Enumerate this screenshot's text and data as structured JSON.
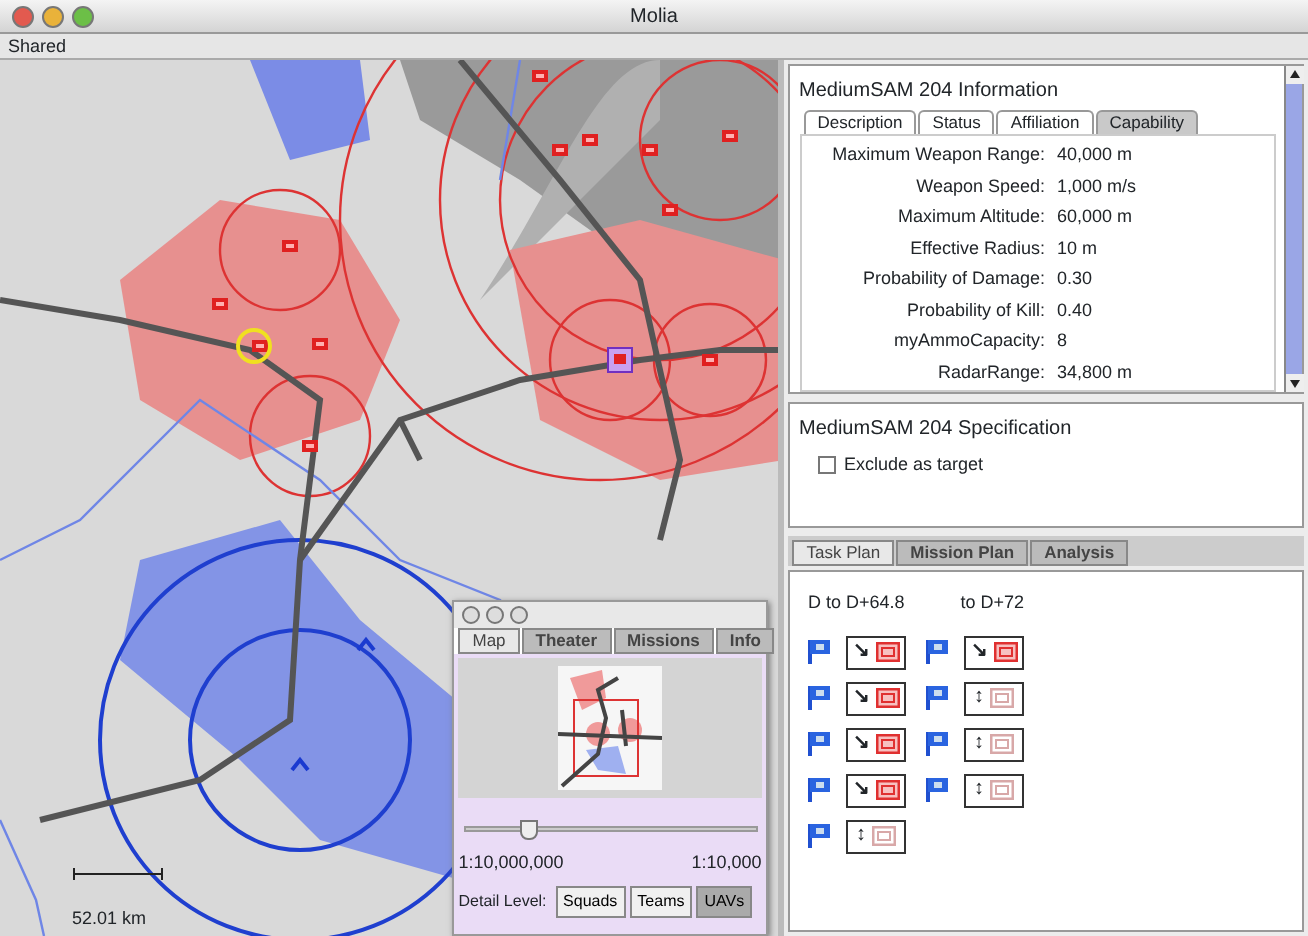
{
  "window": {
    "title": "Molia"
  },
  "menu": [
    "Shared"
  ],
  "map": {
    "scale_label": "52.01 km",
    "palette": {
      "tabs": [
        {
          "label": "Map",
          "selected": true
        },
        {
          "label": "Theater",
          "selected": false
        },
        {
          "label": "Missions",
          "selected": false
        },
        {
          "label": "Info",
          "selected": false
        }
      ],
      "zoom": {
        "level": 0.22
      },
      "scale_min_label": "1:10,000,000",
      "scale_max_label": "1:10,000",
      "detail_label": "Detail Level:",
      "detail_buttons": [
        {
          "label": "Squads",
          "selected": false
        },
        {
          "label": "Teams",
          "selected": false
        },
        {
          "label": "UAVs",
          "selected": true
        }
      ]
    }
  },
  "info": {
    "title": "MediumSAM 204 Information",
    "tabs": [
      {
        "label": "Description",
        "selected": false
      },
      {
        "label": "Status",
        "selected": false
      },
      {
        "label": "Affiliation",
        "selected": false
      },
      {
        "label": "Capability",
        "selected": true
      }
    ],
    "rows": [
      {
        "label": "Maximum Weapon Range:",
        "value": "40,000 m"
      },
      {
        "label": "Weapon Speed:",
        "value": "1,000 m/s"
      },
      {
        "label": "Maximum Altitude:",
        "value": "60,000 m"
      },
      {
        "label": "Effective Radius:",
        "value": "10 m"
      },
      {
        "label": "Probability of Damage:",
        "value": "0.30"
      },
      {
        "label": "Probability of Kill:",
        "value": "0.40"
      },
      {
        "label": "myAmmoCapacity:",
        "value": "8"
      },
      {
        "label": "RadarRange:",
        "value": "34,800 m"
      }
    ]
  },
  "spec": {
    "title": "MediumSAM 204 Specification",
    "exclude": {
      "label": "Exclude as target",
      "checked": false
    }
  },
  "plan": {
    "tabs": [
      {
        "label": "Task Plan",
        "selected": true
      },
      {
        "label": "Mission Plan",
        "selected": false
      },
      {
        "label": "Analysis",
        "selected": false
      }
    ],
    "periods": [
      "D to D+64.8",
      "to D+72"
    ],
    "columns": [
      [
        {
          "arrow": "↘",
          "engaged": true
        },
        {
          "arrow": "↘",
          "engaged": true
        },
        {
          "arrow": "↘",
          "engaged": true
        },
        {
          "arrow": "↘",
          "engaged": true
        },
        {
          "arrow": "↕",
          "engaged": false
        }
      ],
      [
        {
          "arrow": "↘",
          "engaged": true
        },
        {
          "arrow": "↕",
          "engaged": false
        },
        {
          "arrow": "↕",
          "engaged": false
        },
        {
          "arrow": "↕",
          "engaged": false
        }
      ]
    ]
  }
}
